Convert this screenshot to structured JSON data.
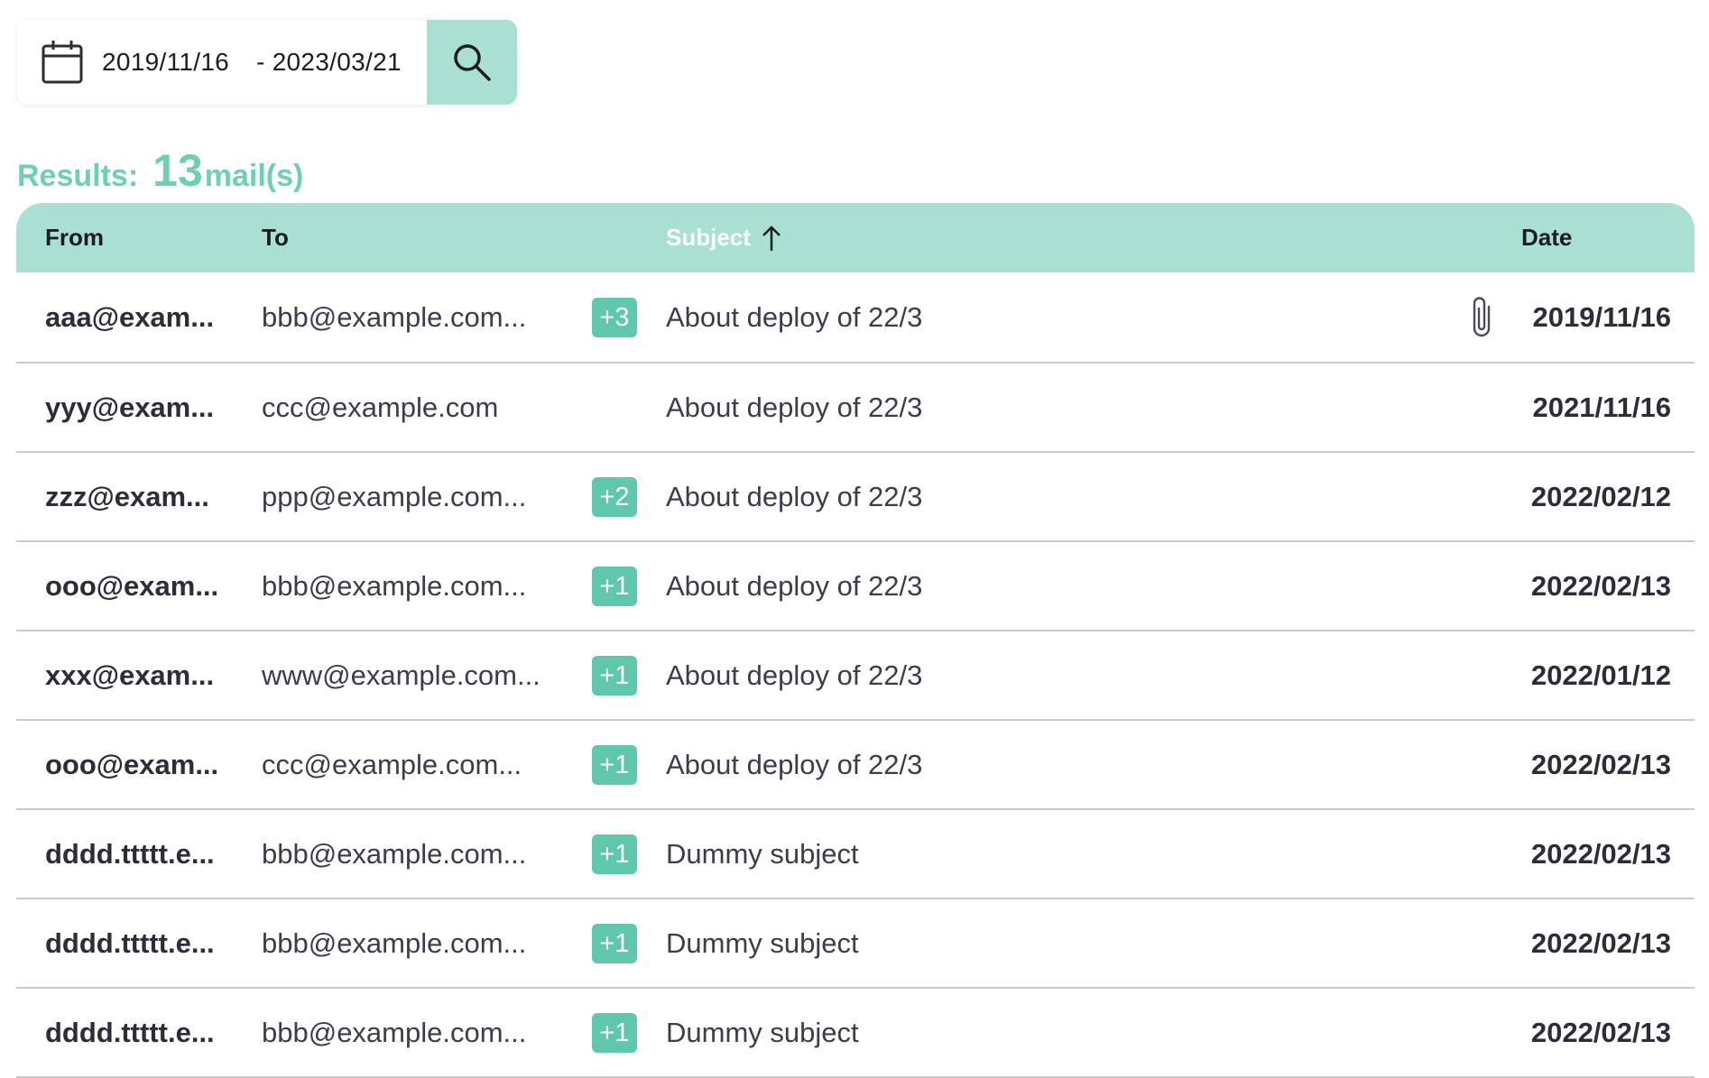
{
  "search": {
    "date_start": "2019/11/16",
    "date_separator": "-",
    "date_end": "2023/03/21"
  },
  "results": {
    "label": "Results:",
    "count": "13",
    "unit": "mail(s)"
  },
  "table": {
    "headers": {
      "from": "From",
      "to": "To",
      "subject": "Subject",
      "date": "Date"
    },
    "sort": {
      "column": "subject",
      "direction": "ascending"
    },
    "rows": [
      {
        "from": "aaa@exam...",
        "to": "bbb@example.com...",
        "extra": "+3",
        "subject": "About deploy of 22/3",
        "attachment": true,
        "date": "2019/11/16"
      },
      {
        "from": "yyy@exam...",
        "to": "ccc@example.com",
        "extra": "",
        "subject": "About deploy of 22/3",
        "attachment": false,
        "date": "2021/11/16"
      },
      {
        "from": "zzz@exam...",
        "to": "ppp@example.com...",
        "extra": "+2",
        "subject": "About deploy of 22/3",
        "attachment": false,
        "date": "2022/02/12"
      },
      {
        "from": "ooo@exam...",
        "to": "bbb@example.com...",
        "extra": "+1",
        "subject": "About deploy of 22/3",
        "attachment": false,
        "date": "2022/02/13"
      },
      {
        "from": "xxx@exam...",
        "to": "www@example.com...",
        "extra": "+1",
        "subject": "About deploy of 22/3",
        "attachment": false,
        "date": "2022/01/12"
      },
      {
        "from": "ooo@exam...",
        "to": "ccc@example.com...",
        "extra": "+1",
        "subject": "About deploy of 22/3",
        "attachment": false,
        "date": "2022/02/13"
      },
      {
        "from": "dddd.ttttt.e...",
        "to": "bbb@example.com...",
        "extra": "+1",
        "subject": "Dummy subject",
        "attachment": false,
        "date": "2022/02/13"
      },
      {
        "from": "dddd.ttttt.e...",
        "to": "bbb@example.com...",
        "extra": "+1",
        "subject": "Dummy subject",
        "attachment": false,
        "date": "2022/02/13"
      },
      {
        "from": "dddd.ttttt.e...",
        "to": "bbb@example.com...",
        "extra": "+1",
        "subject": "Dummy subject",
        "attachment": false,
        "date": "2022/02/13"
      }
    ]
  },
  "colors": {
    "accent": "#aadfd3",
    "badge": "#5fc8ac",
    "results_text": "#6cd0b7"
  }
}
